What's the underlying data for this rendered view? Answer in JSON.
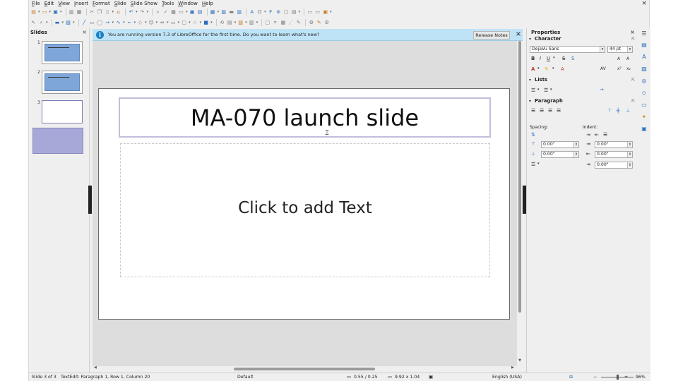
{
  "window": {
    "close_glyph": "×"
  },
  "menu": [
    "File",
    "Edit",
    "View",
    "Insert",
    "Format",
    "Slide",
    "Slide Show",
    "Tools",
    "Window",
    "Help"
  ],
  "slides_pane": {
    "title": "Slides",
    "close": "×",
    "slides": [
      {
        "number": "1"
      },
      {
        "number": "2"
      },
      {
        "number": "3"
      }
    ]
  },
  "infobar": {
    "icon": "i",
    "message": "You are running version 7.3 of LibreOffice for the first time. Do you want to learn what's new?",
    "button": "Release Notes",
    "close": "×"
  },
  "slide": {
    "title": "MA-070 launch slide",
    "content_placeholder": "Click to add Text"
  },
  "properties": {
    "title": "Properties",
    "close": "×",
    "character": {
      "header": "Character",
      "font_name": "DejaVu Sans",
      "font_size": "44 pt"
    },
    "lists": {
      "header": "Lists"
    },
    "paragraph": {
      "header": "Paragraph",
      "spacing_label": "Spacing:",
      "indent_label": "Indent:",
      "spacing_above": "0.00\"",
      "spacing_below": "0.00\"",
      "indent_before": "0.00\"",
      "indent_after": "0.00\"",
      "indent_first": "0.00\""
    }
  },
  "statusbar": {
    "slide": "Slide 3 of 3",
    "edit": "TextEdit: Paragraph 1, Row 1, Column 20",
    "layout": "Default",
    "position": "0.55 / 0.25",
    "size": "9.92 x 1.04",
    "language": "English (USA)",
    "zoom": "96%"
  },
  "colors": {
    "accent": "#1a7fc4",
    "infobar": "#bfe3f6",
    "selection": "#a8a8d8"
  }
}
